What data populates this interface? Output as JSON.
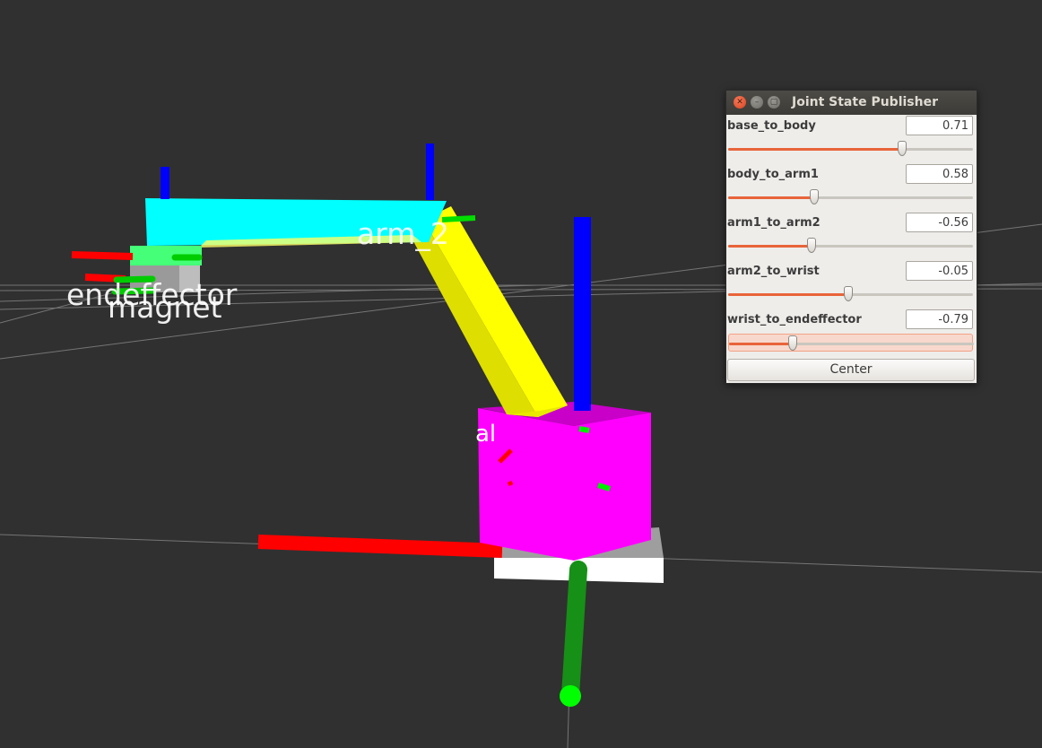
{
  "scene": {
    "labels": [
      "endeffector",
      "magnet",
      "arm_2",
      "al"
    ]
  },
  "window": {
    "title": "Joint State Publisher",
    "close_icon": "close-icon",
    "minimize_icon": "minimize-icon",
    "maximize_icon": "maximize-icon"
  },
  "joints": [
    {
      "name": "base_to_body",
      "value": "0.71",
      "slider_fraction": 0.71
    },
    {
      "name": "body_to_arm1",
      "value": "0.58",
      "slider_fraction": 0.35
    },
    {
      "name": "arm1_to_arm2",
      "value": "-0.56",
      "slider_fraction": 0.34
    },
    {
      "name": "arm2_to_wrist",
      "value": "-0.05",
      "slider_fraction": 0.49
    },
    {
      "name": "wrist_to_endeffector",
      "value": "-0.79",
      "slider_fraction": 0.26,
      "active": true
    }
  ],
  "center_button": "Center",
  "colors": {
    "background": "#303030",
    "accent": "#e8643a",
    "link_cyan": "#00ffff",
    "link_yellow": "#ffff00",
    "link_magenta": "#ff00ff",
    "axis_x": "#ff0000",
    "axis_y": "#00cc00",
    "axis_z": "#0000ff"
  }
}
